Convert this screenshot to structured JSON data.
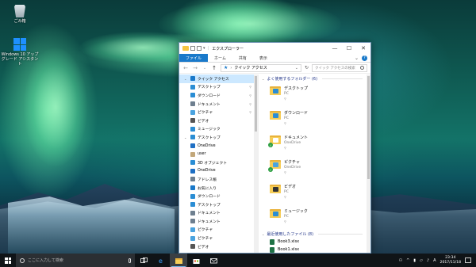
{
  "desktop": {
    "icons": [
      {
        "label": "ごみ箱",
        "icon": "recycle-bin-icon"
      },
      {
        "label": "Windows 10 アップグレード アシスタント",
        "icon": "windows-logo-icon"
      }
    ]
  },
  "window": {
    "title": "エクスプローラー",
    "tabs": [
      {
        "label": "ファイル",
        "active": true
      },
      {
        "label": "ホーム"
      },
      {
        "label": "共有"
      },
      {
        "label": "表示"
      }
    ],
    "address": "クイック アクセス",
    "search_placeholder": "クイック アクセスの検索",
    "nav_items": [
      {
        "label": "クイック アクセス",
        "icon": "star-icon",
        "level": "top",
        "selected": true
      },
      {
        "label": "デスクトップ",
        "icon": "desktop-icon",
        "pinned": true,
        "level": "sub"
      },
      {
        "label": "ダウンロード",
        "icon": "download-icon",
        "pinned": true,
        "level": "sub"
      },
      {
        "label": "ドキュメント",
        "icon": "document-icon",
        "pinned": true,
        "level": "sub"
      },
      {
        "label": "ピクチャ",
        "icon": "picture-icon",
        "pinned": true,
        "level": "sub"
      },
      {
        "label": "ビデオ",
        "icon": "video-icon",
        "level": "sub"
      },
      {
        "label": "ミュージック",
        "icon": "music-icon",
        "level": "sub"
      },
      {
        "label": "デスクトップ",
        "icon": "desktop-icon",
        "level": "top"
      },
      {
        "label": "OneDrive",
        "icon": "cloud-icon",
        "level": "sub"
      },
      {
        "label": "user",
        "icon": "user-icon",
        "level": "sub"
      },
      {
        "label": "3D オブジェクト",
        "icon": "cube-icon",
        "level": "sub"
      },
      {
        "label": "OneDrive",
        "icon": "cloud-icon",
        "level": "sub"
      },
      {
        "label": "アドレス帳",
        "icon": "contacts-icon",
        "level": "sub"
      },
      {
        "label": "お気に入り",
        "icon": "star-icon",
        "level": "sub"
      },
      {
        "label": "ダウンロード",
        "icon": "download-icon",
        "level": "sub"
      },
      {
        "label": "デスクトップ",
        "icon": "desktop-icon",
        "level": "sub"
      },
      {
        "label": "ドキュメント",
        "icon": "document-icon",
        "level": "sub"
      },
      {
        "label": "ドキュメント",
        "icon": "document-icon",
        "level": "sub"
      },
      {
        "label": "ピクチャ",
        "icon": "picture-icon",
        "level": "sub"
      },
      {
        "label": "ピクチャ",
        "icon": "picture-icon",
        "level": "sub"
      },
      {
        "label": "ビデオ",
        "icon": "video-icon",
        "level": "sub"
      }
    ],
    "frequent_header": "よく使用するフォルダー (6)",
    "frequent": [
      {
        "name": "デスクトップ",
        "location": "PC",
        "mark": "desktop",
        "synced": false
      },
      {
        "name": "ダウンロード",
        "location": "PC",
        "mark": "download",
        "synced": false
      },
      {
        "name": "ドキュメント",
        "location": "OneDrive",
        "mark": "document",
        "synced": true
      },
      {
        "name": "ピクチャ",
        "location": "OneDrive",
        "mark": "picture",
        "synced": true
      },
      {
        "name": "ビデオ",
        "location": "PC",
        "mark": "video",
        "synced": false
      },
      {
        "name": "ミュージック",
        "location": "PC",
        "mark": "music",
        "synced": false
      }
    ],
    "recent_header": "最近使用したファイル (8)",
    "recent": [
      {
        "name": "Book3.xlsx"
      },
      {
        "name": "Book1.xlsx"
      }
    ]
  },
  "taskbar": {
    "search_placeholder": "ここに入力して検索",
    "ime": "A",
    "time": "23:34",
    "date": "2017/11/18"
  },
  "colors": {
    "accent": "#1979ca",
    "folder": "#f6cd57",
    "taskbar": "#101417"
  }
}
